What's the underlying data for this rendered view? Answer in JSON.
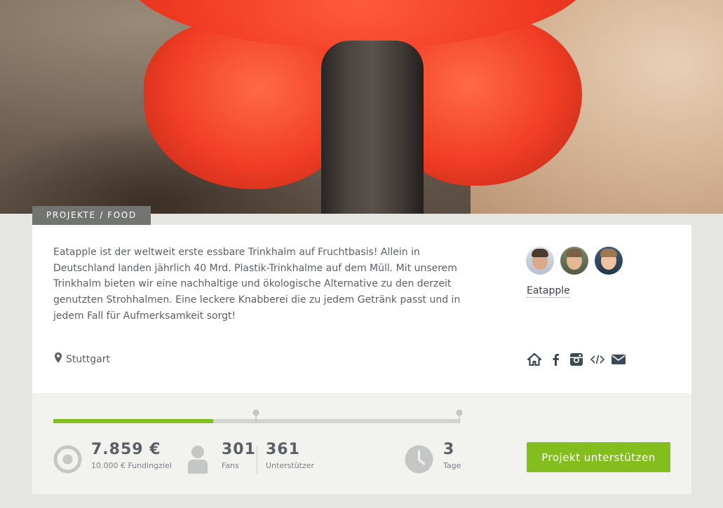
{
  "breadcrumb": "PROJEKTE / FOOD",
  "description": "Eatapple ist der weltweit erste essbare Trinkhalm auf Fruchtbasis! Allein in Deutschland landen jährlich 40 Mrd. Plastik-Trinkhalme auf dem Müll. Mit unserem Trinkhalm bieten wir eine nachhaltige und ökologische Alternative zu den derzeit genutzten Strohhalmen. Eine leckere Knabberei die zu jedem Getränk passt und in jedem Fall für Aufmerksamkeit sorgt!",
  "team": {
    "name": "Eatapple"
  },
  "location": "Stuttgart",
  "social_icons": [
    "home-icon",
    "facebook-icon",
    "instagram-icon",
    "embed-code-icon",
    "mail-icon"
  ],
  "funding": {
    "amount": "7.859 €",
    "goal_label": "10.000 € Fundingziel",
    "progress_fraction": 0.393,
    "fans": "301",
    "fans_label": "Fans",
    "supporters": "361",
    "supporters_label": "Unterstützer",
    "days": "3",
    "days_label": "Tage"
  },
  "cta": {
    "label": "Projekt unterstützen"
  },
  "colors": {
    "accent": "#84bd1e",
    "breadcrumb_bg": "#727471",
    "icon_gray": "#c5c7c4"
  }
}
